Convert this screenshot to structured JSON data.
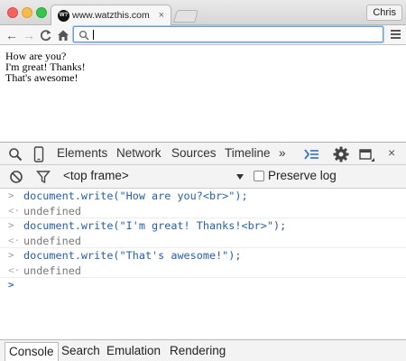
{
  "browser": {
    "tab": {
      "favicon_text": "W?",
      "title": "www.watzthis.com",
      "close": "×"
    },
    "profile_name": "Chris",
    "nav": {
      "back": "←",
      "forward": "→",
      "reload": "C",
      "home": "⌂"
    },
    "omnibox": {
      "value": "",
      "placeholder": ""
    }
  },
  "page": {
    "lines": [
      "How are you?",
      "I'm great! Thanks!",
      "That's awesome!"
    ]
  },
  "devtools": {
    "tabs": [
      "Elements",
      "Network",
      "Sources",
      "Timeline"
    ],
    "more": "»",
    "close": "×",
    "filter": {
      "frame": "<top frame>",
      "preserve_log": "Preserve log"
    },
    "console": [
      {
        "kind": "cmd",
        "gutter": ">",
        "text": "document.write(\"How are you?<br>\");"
      },
      {
        "kind": "res",
        "gutter": "<·",
        "text": "undefined"
      },
      {
        "kind": "cmd",
        "gutter": ">",
        "text": "document.write(\"I'm great! Thanks!<br>\");"
      },
      {
        "kind": "res",
        "gutter": "<·",
        "text": "undefined"
      },
      {
        "kind": "cmd",
        "gutter": ">",
        "text": "document.write(\"That's awesome!\");"
      },
      {
        "kind": "res",
        "gutter": "<·",
        "text": "undefined"
      }
    ],
    "prompt": ">",
    "drawer_tabs": [
      "Console",
      "Search",
      "Emulation",
      "Rendering"
    ],
    "active_drawer_tab": "Console"
  },
  "colors": {
    "accent": "#2c70d6",
    "command_text": "#1f5fbf",
    "result_text": "#777777"
  }
}
